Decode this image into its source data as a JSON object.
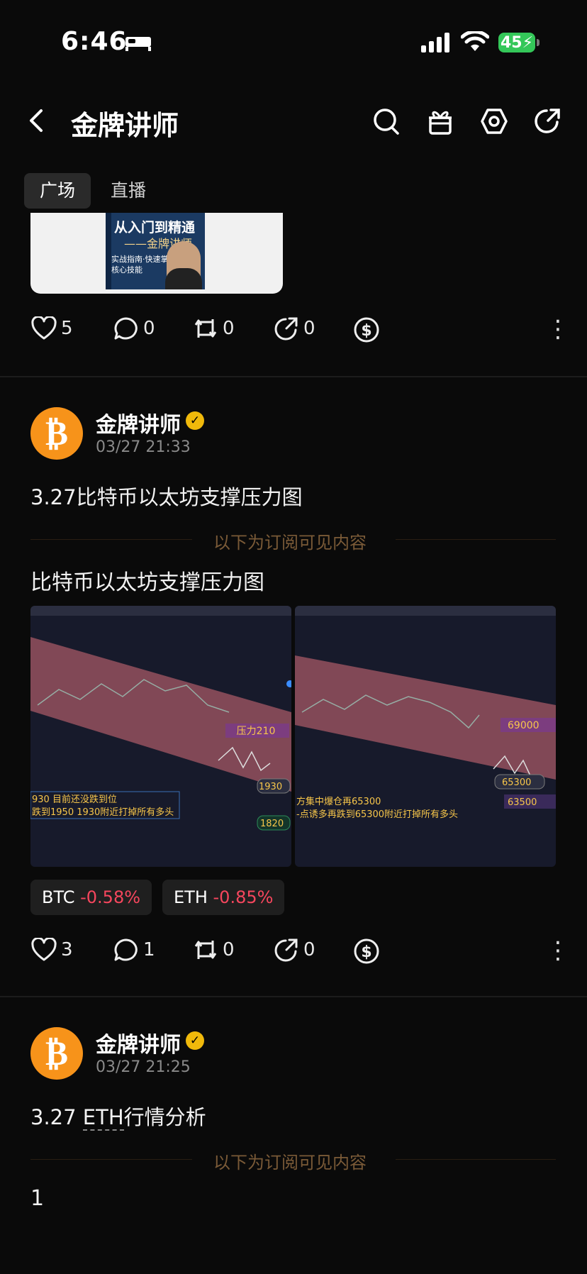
{
  "status_bar": {
    "time": "6:46",
    "battery": "45"
  },
  "header": {
    "title": "金牌讲师"
  },
  "tabs": [
    {
      "label": "广场",
      "active": true
    },
    {
      "label": "直播",
      "active": false
    }
  ],
  "banner": {
    "line1": "从入门到精通",
    "line2": "——金牌讲师",
    "line3": "实战指南·快速掌握交易\n核心技能"
  },
  "post0": {
    "likes": "5",
    "comments": "0",
    "reposts": "0",
    "shares": "0"
  },
  "post1": {
    "author": "金牌讲师",
    "date": "03/27 21:33",
    "title": "3.27比特币以太坊支撑压力图",
    "subscribe_label": "以下为订阅可见内容",
    "body": "比特币以太坊支撑压力图",
    "chart_left": {
      "label_pressure": "压力210",
      "label_1930": "1930",
      "label_1820": "1820",
      "note_line1": "930 目前还没跌到位",
      "note_line2": "跌到1950 1930附近打掉所有多头"
    },
    "chart_right": {
      "label_69000": "69000",
      "label_65300": "65300",
      "label_63500": "63500",
      "note_line1": "方集中爆仓再65300",
      "note_line2": "-点诱多再跌到65300附近打掉所有多头"
    },
    "tags": [
      {
        "symbol": "BTC",
        "change": "-0.58%"
      },
      {
        "symbol": "ETH",
        "change": "-0.85%"
      }
    ],
    "likes": "3",
    "comments": "1",
    "reposts": "0",
    "shares": "0"
  },
  "post2": {
    "author": "金牌讲师",
    "date": "03/27 21:25",
    "title_prefix": "3.27 ",
    "title_link": "ETH",
    "title_suffix": "行情分析",
    "subscribe_label": "以下为订阅可见内容",
    "body": "1"
  },
  "colors": {
    "accent_negative": "#f6465d",
    "bitcoin": "#f7931a",
    "verified": "#f0b90b",
    "subscribe_text": "#7a5a37"
  },
  "icons": [
    "back-icon",
    "search-icon",
    "gift-icon",
    "settings-icon",
    "share-icon",
    "heart-icon",
    "comment-icon",
    "repost-icon",
    "share-arrow-icon",
    "tip-icon",
    "more-icon"
  ]
}
